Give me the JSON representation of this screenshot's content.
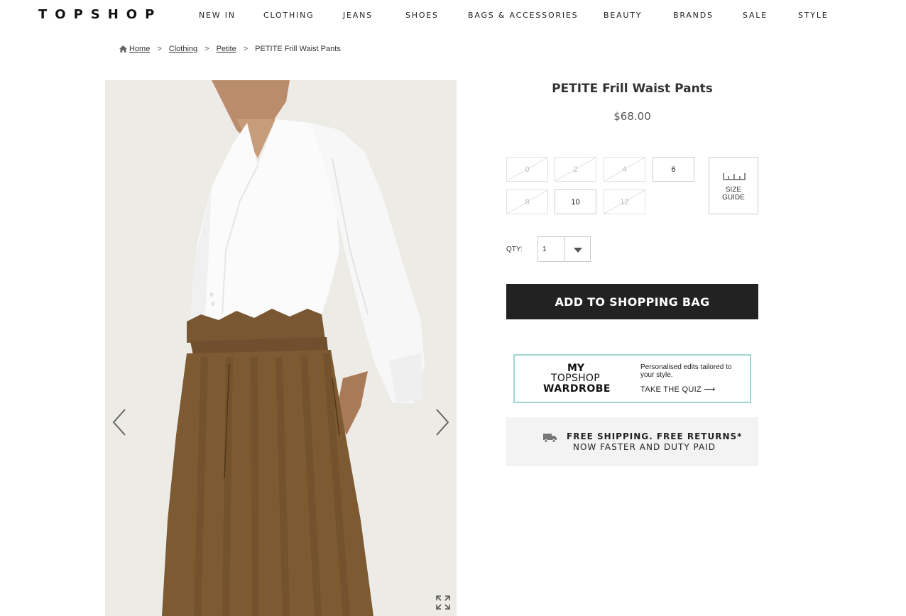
{
  "header": {
    "logo": "TOPSHOP",
    "nav": [
      "NEW IN",
      "CLOTHING",
      "JEANS",
      "SHOES",
      "BAGS & ACCESSORIES",
      "BEAUTY",
      "BRANDS",
      "SALE",
      "STYLE"
    ]
  },
  "breadcrumb": {
    "home": "Home",
    "clothing": "Clothing",
    "petite": "Petite",
    "current": "PETITE Frill Waist Pants",
    "separator": ">"
  },
  "product": {
    "title": "PETITE Frill Waist Pants",
    "price": "$68.00",
    "sizes": [
      {
        "label": "0",
        "available": false
      },
      {
        "label": "2",
        "available": false
      },
      {
        "label": "4",
        "available": false
      },
      {
        "label": "6",
        "available": true
      },
      {
        "label": "8",
        "available": false
      },
      {
        "label": "10",
        "available": true
      },
      {
        "label": "12",
        "available": false
      }
    ],
    "size_guide": {
      "line1": "SIZE",
      "line2": "GUIDE"
    },
    "qty_label": "QTY:",
    "qty_value": "1",
    "add_button": "ADD TO SHOPPING BAG"
  },
  "wardrobe": {
    "my": "MY",
    "topshop": "TOPSHOP",
    "wardrobe": "WARDROBE",
    "desc": "Personalised edits tailored to your style.",
    "quiz": "TAKE THE QUIZ ⟶"
  },
  "shipping": {
    "line1": "FREE SHIPPING. FREE RETURNS*",
    "line2": "NOW FASTER AND DUTY PAID"
  },
  "icons": {
    "home": "home-icon",
    "prev": "chevron-left-icon",
    "next": "chevron-right-icon",
    "expand": "expand-icon",
    "ruler": "ruler-icon",
    "truck": "truck-icon",
    "caret": "caret-down-icon"
  },
  "colors": {
    "button": "#222222",
    "wardrobe_border": "#9fd6cf",
    "shipping_bg": "#f3f3f3",
    "trousers": "#7d5a32"
  }
}
